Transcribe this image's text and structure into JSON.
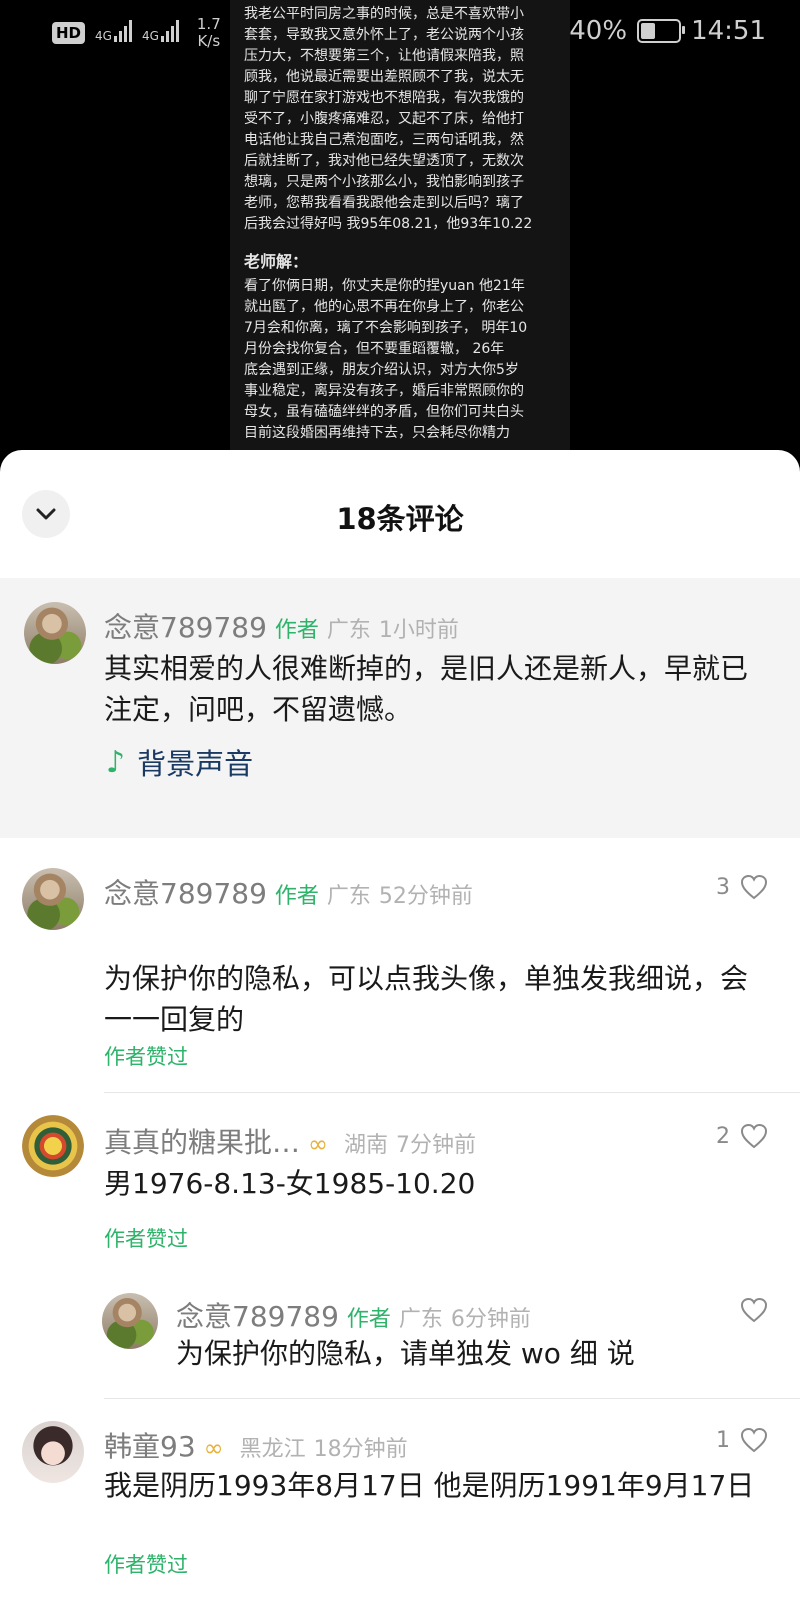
{
  "status_bar": {
    "hd": "HD",
    "net1": "4G",
    "net2": "4G",
    "speed_value": "1.7",
    "speed_unit": "K/s",
    "battery": "40%",
    "battery_level": 0.4,
    "time": "14:51"
  },
  "post": {
    "question_lines": [
      "我老公平时同房之事的时候，总是不喜欢带小",
      "套套，导致我又意外怀上了，老公说两个小孩",
      "压力大，不想要第三个，让他请假来陪我，照",
      "顾我，他说最近需要出差照顾不了我，说太无",
      "聊了宁愿在家打游戏也不想陪我，有次我饿的",
      "受不了，小腹疼痛难忍，又起不了床，给他打",
      "电话他让我自己煮泡面吃，三两句话吼我，然",
      "后就挂断了，我对他已经失望透顶了，无数次",
      "想璃，只是两个小孩那么小，我怕影响到孩子",
      "老师，您帮我看看我跟他会走到以后吗？璃了",
      "后我会过得好吗 我95年08.21，他93年10.22"
    ],
    "teacher_title": "老师解：",
    "answer_lines": [
      "看了你俩日期，你丈夫是你的捏yuan 他21年",
      "就出匦了，他的心思不再在你身上了，你老公",
      "7月会和你离，璃了不会影响到孩子， 明年10",
      "月份会找你复合，但不要重蹈覆辙，    26年",
      "底会遇到正缘，朋友介绍认识，对方大你5岁",
      "事业稳定，离异没有孩子，婚后非常照顾你的",
      "母女，虽有磕磕绊绊的矛盾，但你们可共白头",
      "目前这段婚困再维持下去，只会耗尽你精力"
    ]
  },
  "sheet": {
    "title": "18条评论"
  },
  "pinned": {
    "user": "念意789789",
    "tag": "作者",
    "location": "广东",
    "time": "1小时前",
    "text": "其实相爱的人很难断掉的，是旧人还是新人，早就已注定，问吧，不留遗憾。",
    "music_label": "背景声音"
  },
  "comments": [
    {
      "user": "念意789789",
      "tag": "作者",
      "location": "广东",
      "time": "52分钟前",
      "likes": "3",
      "text": "为保护你的隐私，可以点我头像，单独发我细说，会一一回复的",
      "liked_label": "作者赞过"
    },
    {
      "user": "真真的糖果批…",
      "location": "湖南",
      "time": "7分钟前",
      "likes": "2",
      "text": "男1976-8.13-女1985-10.20",
      "liked_label": "作者赞过",
      "reply": {
        "user": "念意789789",
        "tag": "作者",
        "location": "广东",
        "time": "6分钟前",
        "text": "为保护你的隐私，请单独发 wo 细 说"
      }
    },
    {
      "user": "韩童93",
      "location": "黑龙江",
      "time": "18分钟前",
      "likes": "1",
      "text": "我是阴历1993年8月17日  他是阴历1991年9月17日",
      "liked_label": "作者赞过"
    }
  ],
  "colors": {
    "accent_green": "#2db36a",
    "vip_gold": "#e8b13a"
  }
}
